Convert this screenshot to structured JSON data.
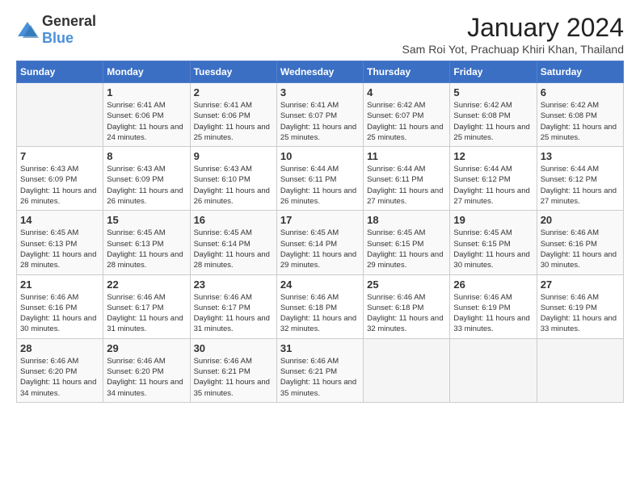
{
  "header": {
    "logo_general": "General",
    "logo_blue": "Blue",
    "month_title": "January 2024",
    "location": "Sam Roi Yot, Prachuap Khiri Khan, Thailand"
  },
  "weekdays": [
    "Sunday",
    "Monday",
    "Tuesday",
    "Wednesday",
    "Thursday",
    "Friday",
    "Saturday"
  ],
  "weeks": [
    [
      {
        "day": "",
        "sunrise": "",
        "sunset": "",
        "daylight": "",
        "empty": true
      },
      {
        "day": "1",
        "sunrise": "Sunrise: 6:41 AM",
        "sunset": "Sunset: 6:06 PM",
        "daylight": "Daylight: 11 hours and 24 minutes."
      },
      {
        "day": "2",
        "sunrise": "Sunrise: 6:41 AM",
        "sunset": "Sunset: 6:06 PM",
        "daylight": "Daylight: 11 hours and 25 minutes."
      },
      {
        "day": "3",
        "sunrise": "Sunrise: 6:41 AM",
        "sunset": "Sunset: 6:07 PM",
        "daylight": "Daylight: 11 hours and 25 minutes."
      },
      {
        "day": "4",
        "sunrise": "Sunrise: 6:42 AM",
        "sunset": "Sunset: 6:07 PM",
        "daylight": "Daylight: 11 hours and 25 minutes."
      },
      {
        "day": "5",
        "sunrise": "Sunrise: 6:42 AM",
        "sunset": "Sunset: 6:08 PM",
        "daylight": "Daylight: 11 hours and 25 minutes."
      },
      {
        "day": "6",
        "sunrise": "Sunrise: 6:42 AM",
        "sunset": "Sunset: 6:08 PM",
        "daylight": "Daylight: 11 hours and 25 minutes."
      }
    ],
    [
      {
        "day": "7",
        "sunrise": "Sunrise: 6:43 AM",
        "sunset": "Sunset: 6:09 PM",
        "daylight": "Daylight: 11 hours and 26 minutes."
      },
      {
        "day": "8",
        "sunrise": "Sunrise: 6:43 AM",
        "sunset": "Sunset: 6:09 PM",
        "daylight": "Daylight: 11 hours and 26 minutes."
      },
      {
        "day": "9",
        "sunrise": "Sunrise: 6:43 AM",
        "sunset": "Sunset: 6:10 PM",
        "daylight": "Daylight: 11 hours and 26 minutes."
      },
      {
        "day": "10",
        "sunrise": "Sunrise: 6:44 AM",
        "sunset": "Sunset: 6:11 PM",
        "daylight": "Daylight: 11 hours and 26 minutes."
      },
      {
        "day": "11",
        "sunrise": "Sunrise: 6:44 AM",
        "sunset": "Sunset: 6:11 PM",
        "daylight": "Daylight: 11 hours and 27 minutes."
      },
      {
        "day": "12",
        "sunrise": "Sunrise: 6:44 AM",
        "sunset": "Sunset: 6:12 PM",
        "daylight": "Daylight: 11 hours and 27 minutes."
      },
      {
        "day": "13",
        "sunrise": "Sunrise: 6:44 AM",
        "sunset": "Sunset: 6:12 PM",
        "daylight": "Daylight: 11 hours and 27 minutes."
      }
    ],
    [
      {
        "day": "14",
        "sunrise": "Sunrise: 6:45 AM",
        "sunset": "Sunset: 6:13 PM",
        "daylight": "Daylight: 11 hours and 28 minutes."
      },
      {
        "day": "15",
        "sunrise": "Sunrise: 6:45 AM",
        "sunset": "Sunset: 6:13 PM",
        "daylight": "Daylight: 11 hours and 28 minutes."
      },
      {
        "day": "16",
        "sunrise": "Sunrise: 6:45 AM",
        "sunset": "Sunset: 6:14 PM",
        "daylight": "Daylight: 11 hours and 28 minutes."
      },
      {
        "day": "17",
        "sunrise": "Sunrise: 6:45 AM",
        "sunset": "Sunset: 6:14 PM",
        "daylight": "Daylight: 11 hours and 29 minutes."
      },
      {
        "day": "18",
        "sunrise": "Sunrise: 6:45 AM",
        "sunset": "Sunset: 6:15 PM",
        "daylight": "Daylight: 11 hours and 29 minutes."
      },
      {
        "day": "19",
        "sunrise": "Sunrise: 6:45 AM",
        "sunset": "Sunset: 6:15 PM",
        "daylight": "Daylight: 11 hours and 30 minutes."
      },
      {
        "day": "20",
        "sunrise": "Sunrise: 6:46 AM",
        "sunset": "Sunset: 6:16 PM",
        "daylight": "Daylight: 11 hours and 30 minutes."
      }
    ],
    [
      {
        "day": "21",
        "sunrise": "Sunrise: 6:46 AM",
        "sunset": "Sunset: 6:16 PM",
        "daylight": "Daylight: 11 hours and 30 minutes."
      },
      {
        "day": "22",
        "sunrise": "Sunrise: 6:46 AM",
        "sunset": "Sunset: 6:17 PM",
        "daylight": "Daylight: 11 hours and 31 minutes."
      },
      {
        "day": "23",
        "sunrise": "Sunrise: 6:46 AM",
        "sunset": "Sunset: 6:17 PM",
        "daylight": "Daylight: 11 hours and 31 minutes."
      },
      {
        "day": "24",
        "sunrise": "Sunrise: 6:46 AM",
        "sunset": "Sunset: 6:18 PM",
        "daylight": "Daylight: 11 hours and 32 minutes."
      },
      {
        "day": "25",
        "sunrise": "Sunrise: 6:46 AM",
        "sunset": "Sunset: 6:18 PM",
        "daylight": "Daylight: 11 hours and 32 minutes."
      },
      {
        "day": "26",
        "sunrise": "Sunrise: 6:46 AM",
        "sunset": "Sunset: 6:19 PM",
        "daylight": "Daylight: 11 hours and 33 minutes."
      },
      {
        "day": "27",
        "sunrise": "Sunrise: 6:46 AM",
        "sunset": "Sunset: 6:19 PM",
        "daylight": "Daylight: 11 hours and 33 minutes."
      }
    ],
    [
      {
        "day": "28",
        "sunrise": "Sunrise: 6:46 AM",
        "sunset": "Sunset: 6:20 PM",
        "daylight": "Daylight: 11 hours and 34 minutes."
      },
      {
        "day": "29",
        "sunrise": "Sunrise: 6:46 AM",
        "sunset": "Sunset: 6:20 PM",
        "daylight": "Daylight: 11 hours and 34 minutes."
      },
      {
        "day": "30",
        "sunrise": "Sunrise: 6:46 AM",
        "sunset": "Sunset: 6:21 PM",
        "daylight": "Daylight: 11 hours and 35 minutes."
      },
      {
        "day": "31",
        "sunrise": "Sunrise: 6:46 AM",
        "sunset": "Sunset: 6:21 PM",
        "daylight": "Daylight: 11 hours and 35 minutes."
      },
      {
        "day": "",
        "sunrise": "",
        "sunset": "",
        "daylight": "",
        "empty": true
      },
      {
        "day": "",
        "sunrise": "",
        "sunset": "",
        "daylight": "",
        "empty": true
      },
      {
        "day": "",
        "sunrise": "",
        "sunset": "",
        "daylight": "",
        "empty": true
      }
    ]
  ]
}
